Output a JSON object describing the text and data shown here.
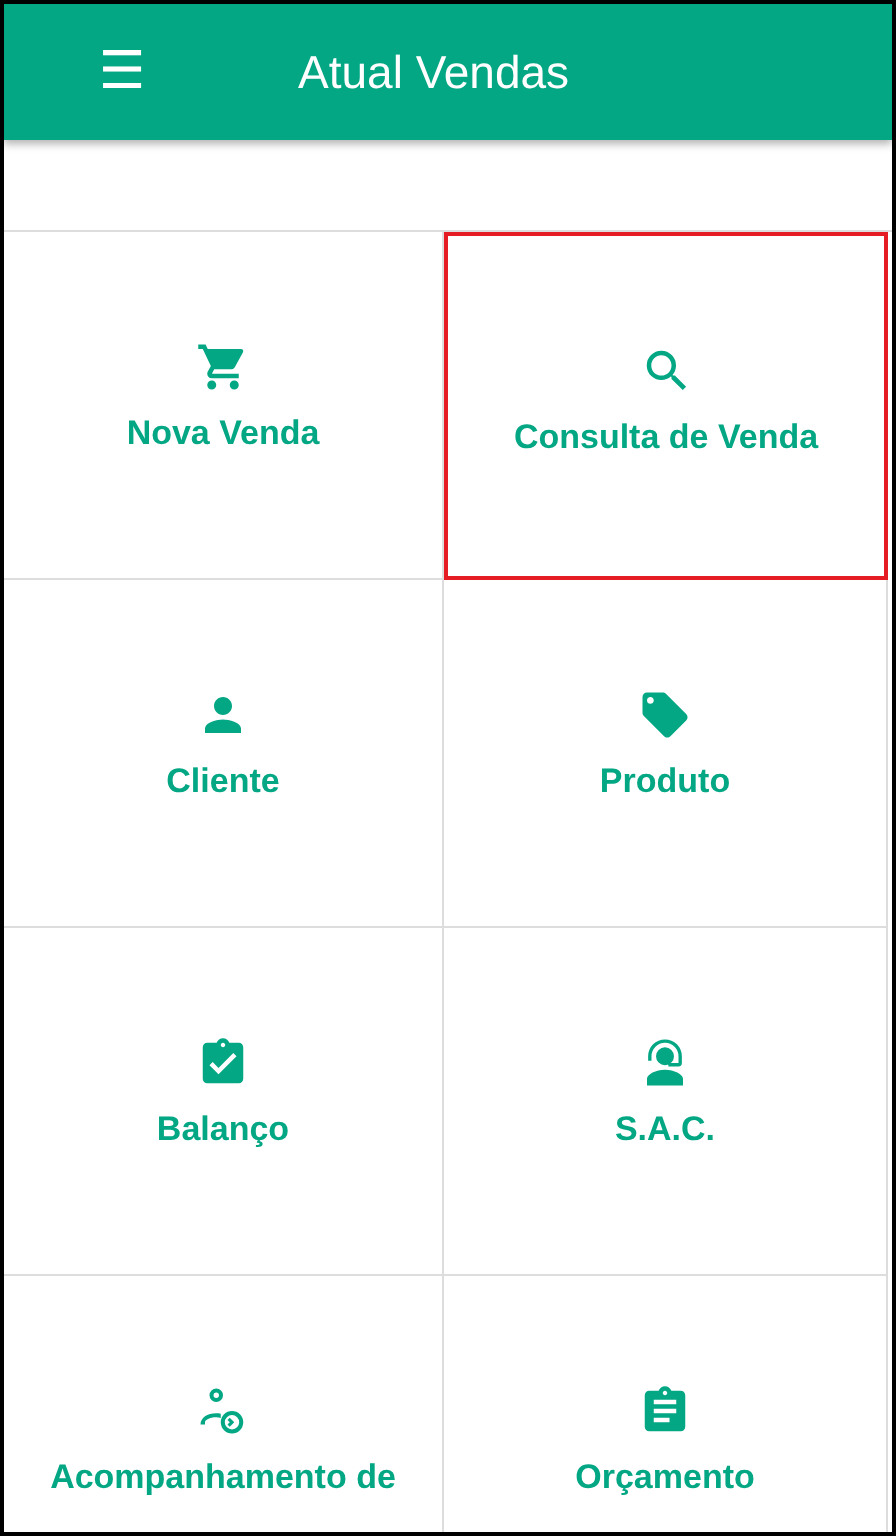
{
  "app_bar": {
    "menu_glyph": "☰",
    "title": "Atual Vendas"
  },
  "menu_tiles": [
    {
      "label": "Nova Venda",
      "selected": false
    },
    {
      "label": "Consulta de Venda",
      "selected": true
    },
    {
      "label": "Cliente",
      "selected": false
    },
    {
      "label": "Produto",
      "selected": false
    },
    {
      "label": "Balanço",
      "selected": false
    },
    {
      "label": "S.A.C.",
      "selected": false
    },
    {
      "label": "Acompanhamento de",
      "selected": false
    },
    {
      "label": "Orçamento",
      "selected": false
    }
  ]
}
